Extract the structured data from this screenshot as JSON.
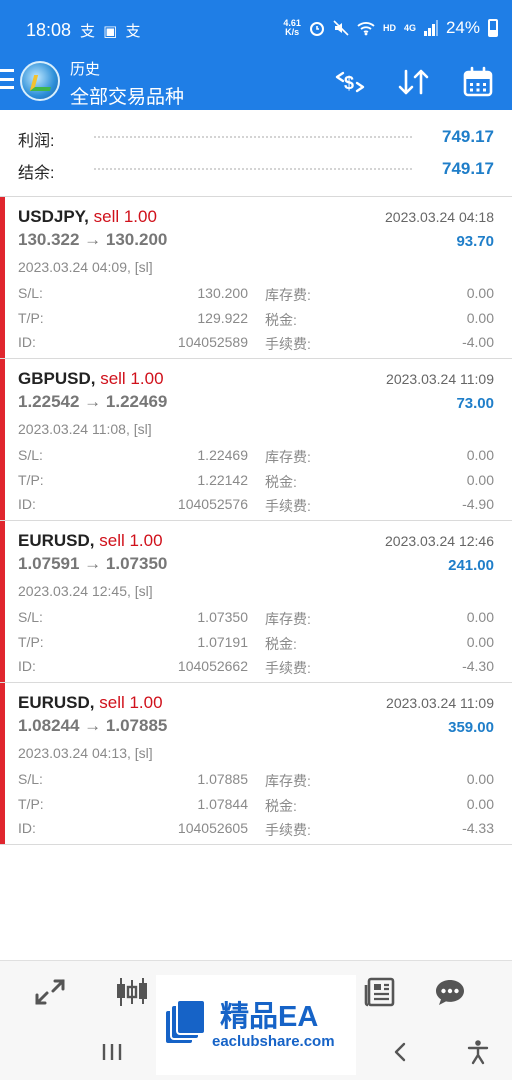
{
  "status_bar": {
    "time": "18:08",
    "left_icons": "支 ▣ 支",
    "net_speed": "4.61",
    "net_unit": "K/s",
    "hd": "HD",
    "signal": "4G",
    "battery_pct": "24%"
  },
  "app_bar": {
    "title": "历史",
    "subtitle": "全部交易品种"
  },
  "summary": {
    "profit_label": "利润:",
    "profit_value": "749.17",
    "balance_label": "结余:",
    "balance_value": "749.17"
  },
  "trades": [
    {
      "symbol": "USDJPY,",
      "side": "sell 1.00",
      "close_time": "2023.03.24 04:18",
      "prices": "130.322 → 130.200",
      "profit": "93.70",
      "open_time": "2023.03.24 04:09, [sl]",
      "sl_label": "S/L:",
      "sl": "130.200",
      "tp_label": "T/P:",
      "tp": "129.922",
      "id_label": "ID:",
      "id": "104052589",
      "swap_label": "库存费:",
      "swap": "0.00",
      "tax_label": "税金:",
      "tax": "0.00",
      "fee_label": "手续费:",
      "fee": "-4.00"
    },
    {
      "symbol": "GBPUSD,",
      "side": "sell 1.00",
      "close_time": "2023.03.24 11:09",
      "prices": "1.22542 → 1.22469",
      "profit": "73.00",
      "open_time": "2023.03.24 11:08, [sl]",
      "sl_label": "S/L:",
      "sl": "1.22469",
      "tp_label": "T/P:",
      "tp": "1.22142",
      "id_label": "ID:",
      "id": "104052576",
      "swap_label": "库存费:",
      "swap": "0.00",
      "tax_label": "税金:",
      "tax": "0.00",
      "fee_label": "手续费:",
      "fee": "-4.90"
    },
    {
      "symbol": "EURUSD,",
      "side": "sell 1.00",
      "close_time": "2023.03.24 12:46",
      "prices": "1.07591 → 1.07350",
      "profit": "241.00",
      "open_time": "2023.03.24 12:45, [sl]",
      "sl_label": "S/L:",
      "sl": "1.07350",
      "tp_label": "T/P:",
      "tp": "1.07191",
      "id_label": "ID:",
      "id": "104052662",
      "swap_label": "库存费:",
      "swap": "0.00",
      "tax_label": "税金:",
      "tax": "0.00",
      "fee_label": "手续费:",
      "fee": "-4.30"
    },
    {
      "symbol": "EURUSD,",
      "side": "sell 1.00",
      "close_time": "2023.03.24 11:09",
      "prices": "1.08244 → 1.07885",
      "profit": "359.00",
      "open_time": "2023.03.24 04:13, [sl]",
      "sl_label": "S/L:",
      "sl": "1.07885",
      "tp_label": "T/P:",
      "tp": "1.07844",
      "id_label": "ID:",
      "id": "104052605",
      "swap_label": "库存费:",
      "swap": "0.00",
      "tax_label": "税金:",
      "tax": "0.00",
      "fee_label": "手续费:",
      "fee": "-4.33"
    }
  ],
  "watermark": {
    "brand": "精品EA",
    "site": "eaclubshare.com"
  },
  "colors": {
    "app_blue": "#1f7ee6",
    "profit_blue": "#1f7ec9",
    "sell_red": "#d0111b",
    "trade_bar_red": "#e0262e"
  },
  "icons": {
    "app_bar": [
      "menu-icon",
      "app-logo-icon",
      "currency-filter-icon",
      "sort-icon",
      "calendar-icon"
    ],
    "bottom_nav": [
      "quotes-icon",
      "chart-icon",
      "history-icon",
      "messages-icon"
    ],
    "system_nav": [
      "recent-apps-icon",
      "back-icon",
      "accessibility-icon"
    ]
  }
}
